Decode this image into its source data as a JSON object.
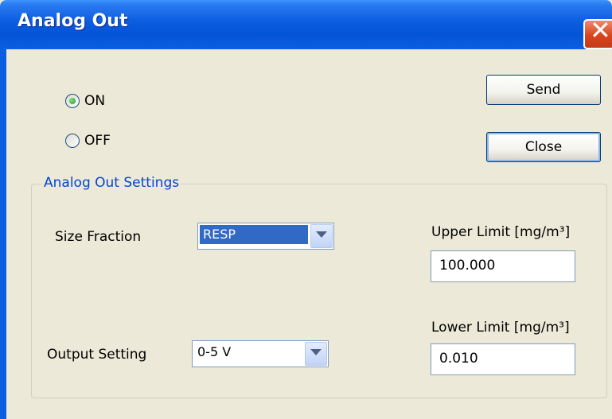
{
  "window": {
    "title": "Analog Out",
    "close_glyph": "✕"
  },
  "power": {
    "on_label": "ON",
    "off_label": "OFF",
    "selected": "ON"
  },
  "buttons": {
    "send_label": "Send",
    "close_label": "Close"
  },
  "settings": {
    "group_title": "Analog Out Settings",
    "size_fraction_label": "Size Fraction",
    "size_fraction_value": "RESP",
    "output_setting_label": "Output Setting",
    "output_setting_value": "0-5 V",
    "upper_limit_label": "Upper Limit [mg/m³]",
    "upper_limit_value": "100.000",
    "lower_limit_label": "Lower Limit [mg/m³]",
    "lower_limit_value": "0.010"
  },
  "icons": {
    "close": "close-icon",
    "dropdown": "chevron-down-icon",
    "radio_selected": "radio-selected-icon",
    "radio_unselected": "radio-unselected-icon"
  }
}
